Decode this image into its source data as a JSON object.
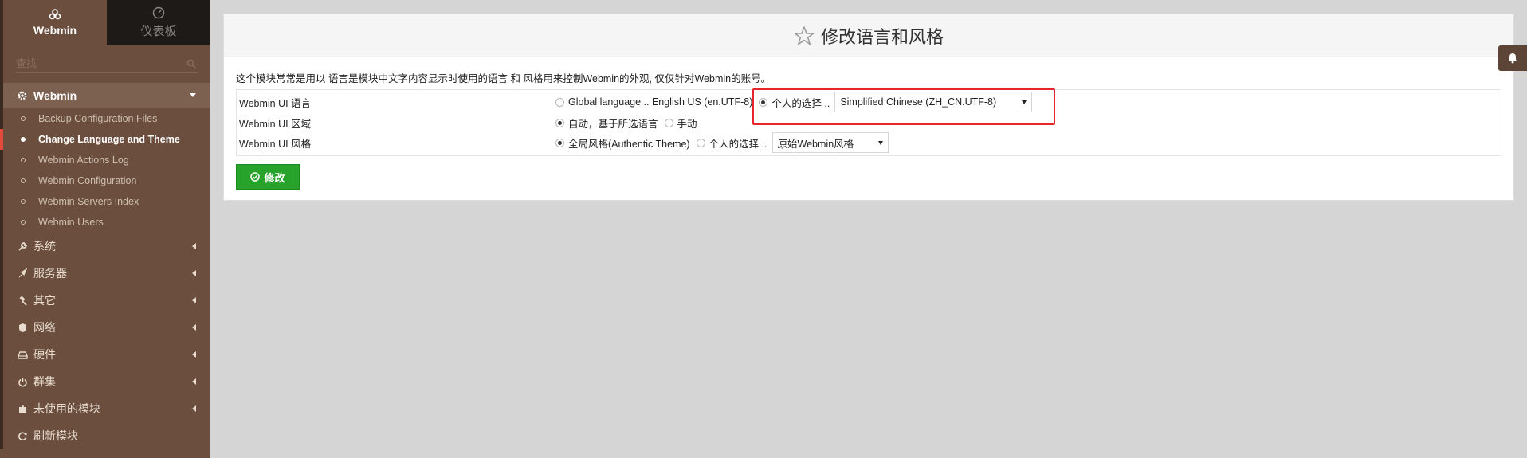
{
  "sidebar": {
    "tabs": [
      {
        "label": "Webmin",
        "icon": "webmin-logo-icon"
      },
      {
        "label": "仪表板",
        "icon": "dashboard-icon"
      }
    ],
    "search": {
      "placeholder": "查找"
    },
    "section": {
      "label": "Webmin",
      "icon": "gear-icon"
    },
    "items": [
      {
        "label": "Backup Configuration Files"
      },
      {
        "label": "Change Language and Theme"
      },
      {
        "label": "Webmin Actions Log"
      },
      {
        "label": "Webmin Configuration"
      },
      {
        "label": "Webmin Servers Index"
      },
      {
        "label": "Webmin Users"
      }
    ],
    "active_item": "Change Language and Theme",
    "categories": [
      {
        "label": "系统",
        "icon": "wrench-icon"
      },
      {
        "label": "服务器",
        "icon": "rocket-icon"
      },
      {
        "label": "其它",
        "icon": "gavel-icon"
      },
      {
        "label": "网络",
        "icon": "shield-icon"
      },
      {
        "label": "硬件",
        "icon": "hdd-icon"
      },
      {
        "label": "群集",
        "icon": "power-icon"
      },
      {
        "label": "未使用的模块",
        "icon": "puzzle-icon"
      },
      {
        "label": "刷新模块",
        "icon": "refresh-icon"
      }
    ]
  },
  "main": {
    "title": "修改语言和风格",
    "description": "这个模块常常是用以 语言是模块中文字内容显示时使用的语言 和 风格用来控制Webmin的外观, 仅仅针对Webmin的账号。",
    "rows": {
      "language": {
        "label": "Webmin UI 语言",
        "global_option": "Global language .. English US (en.UTF-8)",
        "personal_option": "个人的选择 ..",
        "selected_value": "Simplified Chinese (ZH_CN.UTF-8)",
        "selected": "personal"
      },
      "locale": {
        "label": "Webmin UI 区域",
        "auto_option": "自动，基于所选语言",
        "manual_option": "手动",
        "selected": "auto"
      },
      "theme": {
        "label": "Webmin UI 风格",
        "global_option": "全局风格(Authentic Theme)",
        "personal_option": "个人的选择 ..",
        "selected_value": "原始Webmin风格",
        "selected": "global"
      }
    },
    "save_label": "修改"
  },
  "colors": {
    "sidebar_bg": "#6b4e3d",
    "active_marker": "#e24b3b",
    "save_button": "#27a32b",
    "highlight_box": "#e5262a"
  }
}
